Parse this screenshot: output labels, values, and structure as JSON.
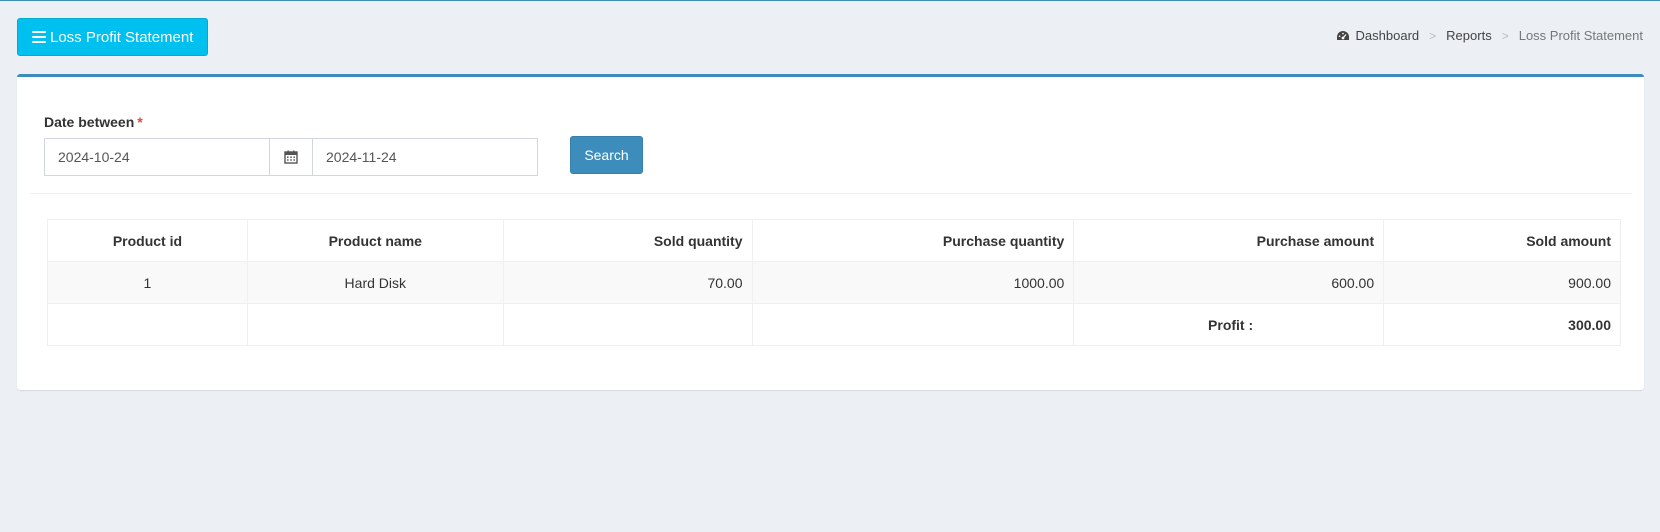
{
  "header": {
    "title_button": "Loss Profit Statement",
    "title_icon": "bars-icon"
  },
  "breadcrumb": {
    "dashboard": "Dashboard",
    "reports": "Reports",
    "current": "Loss Profit Statement",
    "separator": ">"
  },
  "filter": {
    "label": "Date between",
    "required_mark": "*",
    "date_from": "2024-10-24",
    "date_to": "2024-11-24",
    "calendar_icon": "calendar-icon",
    "search_label": "Search"
  },
  "table": {
    "columns": [
      "Product id",
      "Product name",
      "Sold quantity",
      "Purchase quantity",
      "Purchase amount",
      "Sold amount"
    ],
    "rows": [
      {
        "product_id": "1",
        "product_name": "Hard Disk",
        "sold_quantity": "70.00",
        "purchase_quantity": "1000.00",
        "purchase_amount": "600.00",
        "sold_amount": "900.00"
      }
    ],
    "footer": {
      "profit_label": "Profit :",
      "profit_value": "300.00"
    }
  },
  "colors": {
    "accent": "#3c8dbc",
    "title_button": "#00c0ef",
    "background": "#ecf0f5",
    "required": "#dd4b39"
  }
}
